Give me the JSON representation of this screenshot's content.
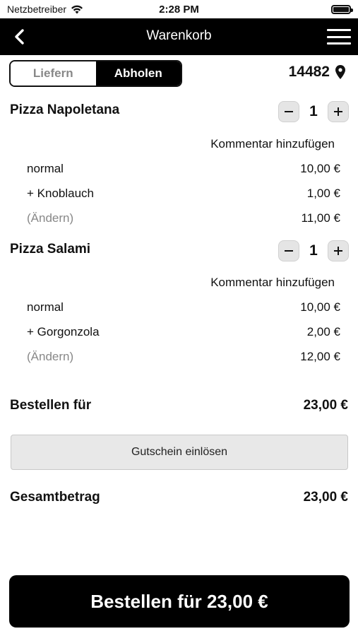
{
  "status_bar": {
    "carrier": "Netzbetreiber",
    "time": "2:28 PM",
    "battery_level": 1.0
  },
  "nav": {
    "title": "Warenkorb",
    "back_icon": "chevron-left-icon",
    "menu_icon": "hamburger-menu-icon"
  },
  "delivery_mode": {
    "options": [
      "Liefern",
      "Abholen"
    ],
    "selected": "Abholen"
  },
  "postal_code": "14482",
  "items": [
    {
      "name": "Pizza Napoletana",
      "quantity": "1",
      "comment_link": "Kommentar hinzufügen",
      "lines": [
        {
          "label": "normal",
          "price": "10,00 €"
        },
        {
          "label": "+ Knoblauch",
          "price": "1,00 €"
        },
        {
          "label": "(Ändern)",
          "price": "11,00 €"
        }
      ]
    },
    {
      "name": "Pizza Salami",
      "quantity": "1",
      "comment_link": "Kommentar hinzufügen",
      "lines": [
        {
          "label": "normal",
          "price": "10,00 €"
        },
        {
          "label": "+ Gorgonzola",
          "price": "2,00 €"
        },
        {
          "label": "(Ändern)",
          "price": "12,00 €"
        }
      ]
    }
  ],
  "subtotal": {
    "label": "Bestellen für",
    "value": "23,00 €"
  },
  "voucher_button": "Gutschein einlösen",
  "total": {
    "label": "Gesamtbetrag",
    "value": "23,00 €"
  },
  "order_button": "Bestellen für 23,00 €",
  "colors": {
    "primary": "#000000",
    "muted": "#888888",
    "button_gray": "#e8e8e8"
  }
}
